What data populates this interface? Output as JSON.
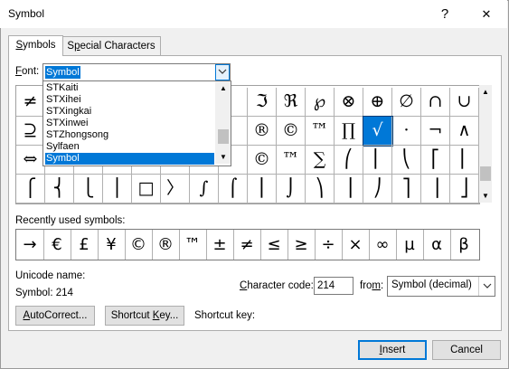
{
  "window": {
    "title": "Symbol",
    "help_glyph": "?",
    "close_glyph": "✕"
  },
  "tabs": [
    {
      "label": "Symbols",
      "accel": "S",
      "rest": "ymbols",
      "active": true
    },
    {
      "label": "Special Characters",
      "accel": "P",
      "pre": "S",
      "rest": "ecial Characters",
      "active": false
    }
  ],
  "font": {
    "label": "Font:",
    "value": "Symbol"
  },
  "font_dropdown": {
    "items": [
      "STKaiti",
      "STXihei",
      "STXingkai",
      "STXinwei",
      "STZhongsong",
      "Sylfaen",
      "Symbol"
    ],
    "selected": "Symbol"
  },
  "symbol_grid": {
    "rows": [
      [
        "≠",
        "",
        "",
        "",
        "",
        "",
        "",
        "",
        "ℑ",
        "ℜ",
        "℘",
        "⊗",
        "⊕",
        "∅",
        "∩",
        "∪",
        "⊃"
      ],
      [
        "⊇",
        "",
        "",
        "",
        "",
        "",
        "",
        "",
        "®",
        "©",
        "™",
        "∏",
        "√",
        "·",
        "¬",
        "∧",
        "∨"
      ],
      [
        "⇔",
        "",
        "",
        "",
        "",
        "",
        "",
        "",
        "©",
        "™",
        "∑",
        "⎛",
        "⎜",
        "⎝",
        "⎡",
        "⎢",
        "⎣"
      ],
      [
        "⎧",
        "⎨",
        "⎩",
        "⎪",
        "□",
        "〉",
        "∫",
        "⌠",
        "⎮",
        "⌡",
        "⎞",
        "⎟",
        "⎠",
        "⎤",
        "⎥",
        "⎦",
        "⎫"
      ]
    ],
    "selected_symbol": "√"
  },
  "recently_used": {
    "label": "Recently used symbols:",
    "symbols": [
      "→",
      "€",
      "£",
      "¥",
      "©",
      "®",
      "™",
      "±",
      "≠",
      "≤",
      "≥",
      "÷",
      "×",
      "∞",
      "µ",
      "α",
      "β"
    ]
  },
  "unicode_name": {
    "label": "Unicode name:",
    "value": "Symbol: 214"
  },
  "character_code": {
    "label": "Character code:",
    "value": "214"
  },
  "from": {
    "label": "from:",
    "value": "Symbol (decimal)"
  },
  "buttons": {
    "autocorrect": "AutoCorrect...",
    "shortcut_key": "Shortcut Key...",
    "shortcut_key_label": "Shortcut key:",
    "insert": "Insert",
    "cancel": "Cancel"
  },
  "colors": {
    "selection": "#0078d7",
    "dialog_bg": "#f0f0f0"
  }
}
